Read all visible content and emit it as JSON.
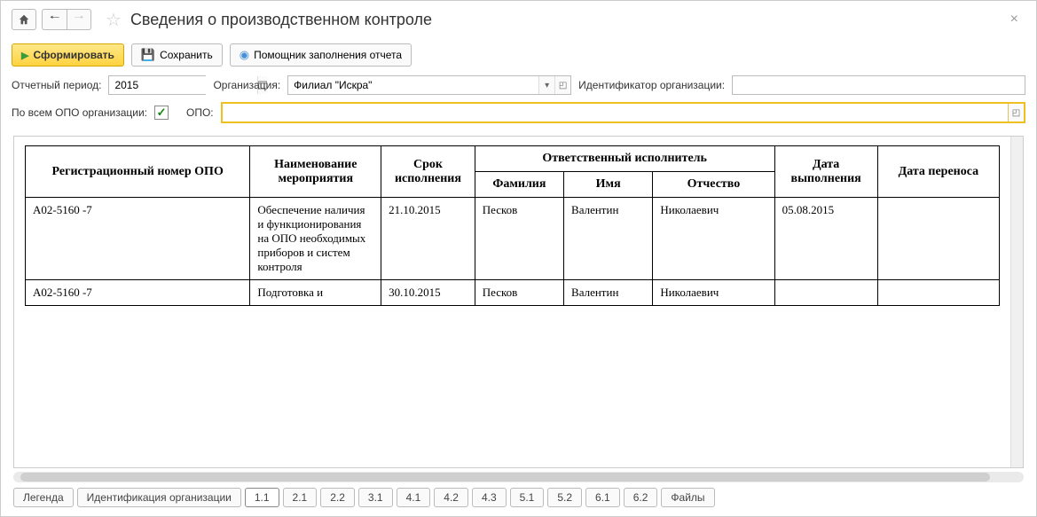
{
  "header": {
    "title": "Сведения о производственном контроле"
  },
  "toolbar": {
    "form_btn": "Сформировать",
    "save_btn": "Сохранить",
    "helper_btn": "Помощник заполнения отчета"
  },
  "form": {
    "period_label": "Отчетный период:",
    "period_value": "2015",
    "org_label": "Организация:",
    "org_value": "Филиал \"Искра\"",
    "org_id_label": "Идентификатор организации:",
    "org_id_value": "",
    "all_opo_label": "По всем ОПО организации:",
    "all_opo_checked": "✓",
    "opo_label": "ОПО:",
    "opo_value": ""
  },
  "table": {
    "headers": {
      "reg_num": "Регистрационный номер ОПО",
      "event_name": "Наименование мероприятия",
      "due_date": "Срок исполнения",
      "responsible": "Ответственный исполнитель",
      "surname": "Фамилия",
      "name": "Имя",
      "patronymic": "Отчество",
      "complete_date": "Дата выполнения",
      "transfer_date": "Дата переноса"
    },
    "rows": [
      {
        "reg_num": "А02-5160 -7",
        "event_name": "Обеспечение наличия и функционирования на ОПО необходимых приборов и систем контроля",
        "due_date": "21.10.2015",
        "surname": "Песков",
        "name": "Валентин",
        "patronymic": "Николаевич",
        "complete_date": "05.08.2015",
        "transfer_date": ""
      },
      {
        "reg_num": "А02-5160 -7",
        "event_name": "Подготовка и",
        "due_date": "30.10.2015",
        "surname": "Песков",
        "name": "Валентин",
        "patronymic": "Николаевич",
        "complete_date": "",
        "transfer_date": ""
      }
    ]
  },
  "tabs": [
    "Легенда",
    "Идентификация организации",
    "1.1",
    "2.1",
    "2.2",
    "3.1",
    "4.1",
    "4.2",
    "4.3",
    "5.1",
    "5.2",
    "6.1",
    "6.2",
    "Файлы"
  ],
  "active_tab": "1.1"
}
